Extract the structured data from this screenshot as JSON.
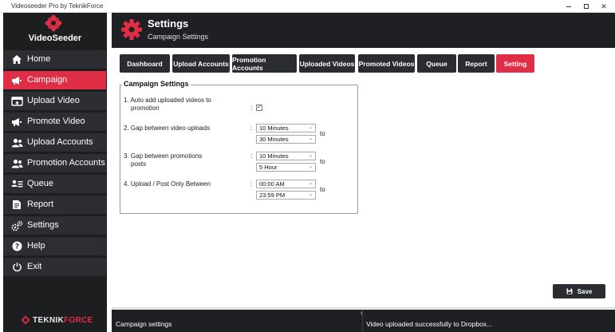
{
  "window": {
    "title": "Videoseeder Pro by TeknikForce"
  },
  "brand": {
    "name": "VideoSeeder",
    "footer_logo_prefix": "TEKNIK",
    "footer_logo_suffix": "FORCE",
    "accent_color": "#e02e47"
  },
  "sidebar": {
    "items": [
      {
        "label": "Home",
        "icon": "home-icon",
        "active": false
      },
      {
        "label": "Campaign",
        "icon": "megaphone-icon",
        "active": true
      },
      {
        "label": "Upload Video",
        "icon": "video-upload-icon",
        "active": false
      },
      {
        "label": "Promote Video",
        "icon": "megaphone-icon",
        "active": false
      },
      {
        "label": "Upload Accounts",
        "icon": "users-icon",
        "active": false
      },
      {
        "label": "Promotion Accounts",
        "icon": "users-icon",
        "active": false
      },
      {
        "label": "Queue",
        "icon": "queue-icon",
        "active": false
      },
      {
        "label": "Report",
        "icon": "report-icon",
        "active": false
      },
      {
        "label": "Settings",
        "icon": "gears-icon",
        "active": false
      },
      {
        "label": "Help",
        "icon": "help-icon",
        "active": false
      },
      {
        "label": "Exit",
        "icon": "power-icon",
        "active": false
      }
    ]
  },
  "header": {
    "title": "Settings",
    "subtitle": "Campaign Settings"
  },
  "tabs": [
    {
      "label": "Dashboard",
      "active": false
    },
    {
      "label": "Upload Accounts",
      "active": false
    },
    {
      "label": "Promotion Accounts",
      "active": false
    },
    {
      "label": "Uploaded Videos",
      "active": false
    },
    {
      "label": "Promoted Videos",
      "active": false
    },
    {
      "label": "Queue",
      "active": false
    },
    {
      "label": "Report",
      "active": false
    },
    {
      "label": "Setting",
      "active": true
    }
  ],
  "campaign_settings": {
    "legend": "Campaign Settings",
    "auto_add": {
      "label_line1": "1. Auto add uploaded videos to",
      "label_line2": "promotion",
      "checked": true
    },
    "gap_uploads": {
      "label": "2. Gap between video uploads",
      "from": "10 Minutes",
      "to": "30 Minutes",
      "to_label": "to"
    },
    "gap_promotions": {
      "label_line1": "3. Gap between promotions",
      "label_line2": "posts",
      "from": "10 Minutes",
      "to": "5 Hour",
      "to_label": "to"
    },
    "upload_window": {
      "label": "4. Upload / Post Only Between",
      "from": "00:00 AM",
      "to": "23:59 PM",
      "to_label": "to"
    },
    "colon": ":"
  },
  "save_button": {
    "label": "Save"
  },
  "status": {
    "left": "Campaign settings",
    "right": "Video uploaded successfully to Dropbox..."
  }
}
